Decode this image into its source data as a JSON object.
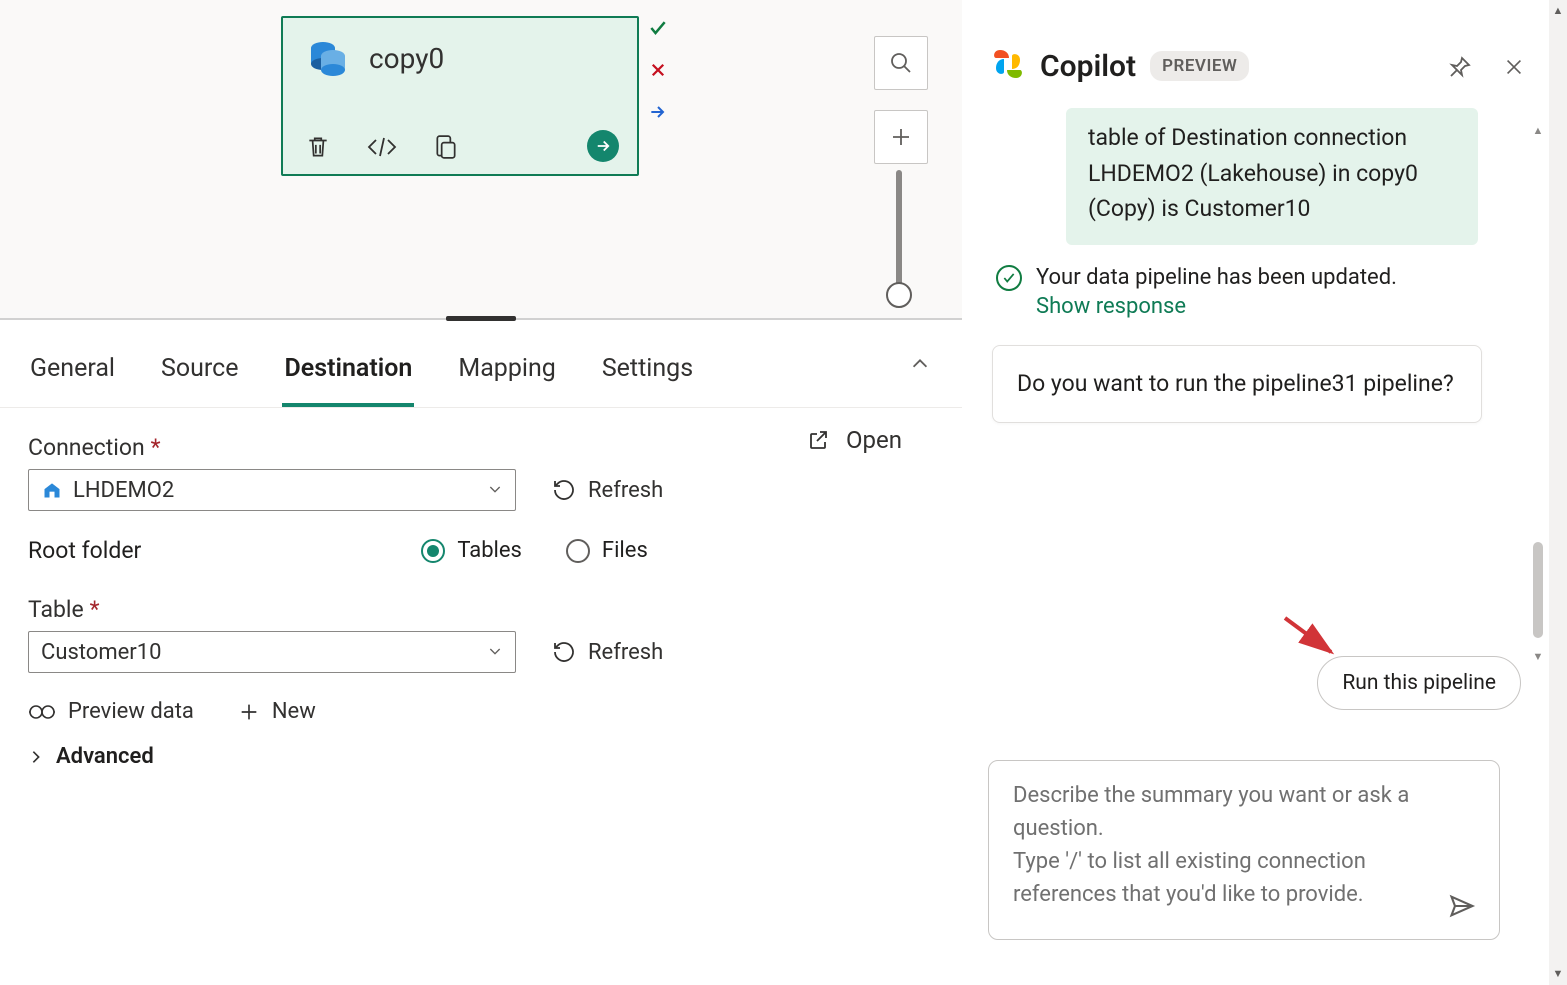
{
  "canvas": {
    "activity": {
      "title": "copy0"
    },
    "status": {
      "success_color": "#107c41",
      "error_color": "#c50f1f",
      "continue_color": "#2264d1"
    }
  },
  "tabs": {
    "general": "General",
    "source": "Source",
    "destination": "Destination",
    "mapping": "Mapping",
    "settings": "Settings",
    "active": "destination"
  },
  "destination": {
    "connection_label": "Connection",
    "connection_value": "LHDEMO2",
    "refresh": "Refresh",
    "open": "Open",
    "root_folder_label": "Root folder",
    "root_tables": "Tables",
    "root_files": "Files",
    "root_selected": "Tables",
    "table_label": "Table",
    "table_value": "Customer10",
    "preview_data": "Preview data",
    "new": "New",
    "advanced": "Advanced"
  },
  "copilot": {
    "title": "Copilot",
    "badge": "PREVIEW",
    "green_msg": "table of Destination connection LHDEMO2 (Lakehouse) in copy0 (Copy) is Customer10",
    "status_msg": "Your data pipeline has been updated.",
    "show_response": "Show response",
    "followup": "Do you want to run the pipeline31 pipeline?",
    "run_pill": "Run this pipeline",
    "placeholder": "Describe the summary you want or ask a question.\nType '/' to list all existing connection references that you'd like to provide."
  }
}
